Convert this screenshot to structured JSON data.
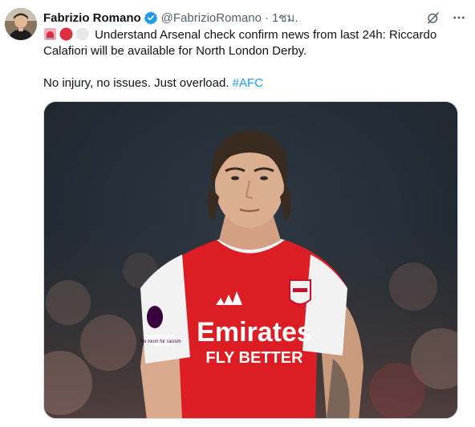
{
  "author": {
    "display_name": "Fabrizio Romano",
    "handle": "@FabrizioRomano",
    "separator": "·",
    "time": "1ชม."
  },
  "header_icons": [
    "grok-icon",
    "more-icon"
  ],
  "tweet": {
    "line1": "Understand Arsenal check confirm news from last 24h: Riccardo",
    "line2": "Calafiori will be available for North London Derby.",
    "line3": "No injury, no issues. Just overload.",
    "hashtag": "#AFC",
    "emojis": [
      "rotating-light-emoji",
      "red-circle-emoji",
      "white-circle-emoji"
    ]
  },
  "media": {
    "shirt_sponsor_line1": "Emirates",
    "shirt_sponsor_line2": "FLY BETTER",
    "sleeve_badge": "No room for racism",
    "colors": {
      "shirt_red": "#dc1e24",
      "shirt_white": "#f2f2f2",
      "background_dark": "#26303a"
    }
  },
  "colors": {
    "text": "#0f1419",
    "secondary": "#536471",
    "link": "#1d9bf0",
    "verified": "#1d9bf0"
  }
}
